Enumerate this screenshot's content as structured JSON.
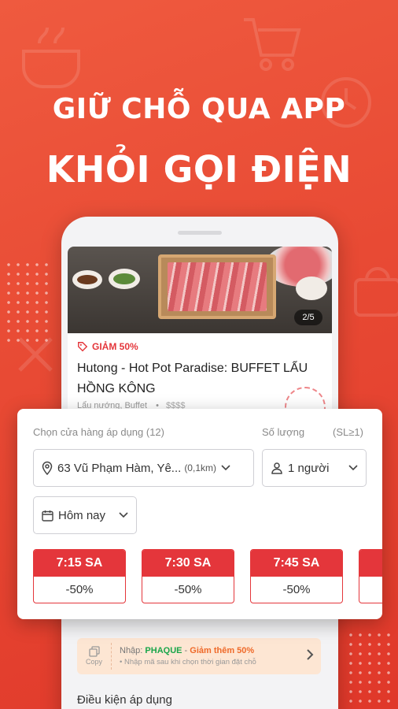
{
  "headline": {
    "line1": "GIỮ CHỖ QUA APP",
    "line2": "KHỎI GỌI ĐIỆN"
  },
  "colors": {
    "brand_red": "#e4363b",
    "background_gradient_start": "#ef5a3f",
    "background_gradient_end": "#e0382a",
    "promo_code_green": "#1aa64a",
    "promo_extra_orange": "#ef6a2a"
  },
  "restaurant_card": {
    "image_counter": "2/5",
    "discount_tag": "GIẢM 50%",
    "title": "Hutong - Hot Pot Paradise: BUFFET LẨU HỒNG KÔNG",
    "category": "Lẩu nướng, Buffet",
    "separator": "•",
    "price_level": "$$$$"
  },
  "booking": {
    "store_label": "Chọn cửa hàng áp dụng (12)",
    "quantity_label": "Số lượng",
    "quantity_hint": "(SL≥1)",
    "store_value": "63 Vũ Phạm Hàm, Yê...",
    "store_distance": "(0,1km)",
    "quantity_value": "1 người",
    "date_value": "Hôm nay",
    "time_slots": [
      {
        "time": "7:15 SA",
        "discount": "-50%"
      },
      {
        "time": "7:30 SA",
        "discount": "-50%"
      },
      {
        "time": "7:45 SA",
        "discount": "-50%"
      }
    ]
  },
  "promo": {
    "copy_label": "Copy",
    "prefix": "Nhập:",
    "code": "PHAQUE",
    "dash": " - ",
    "extra": "Giảm thêm 50%",
    "sub": "• Nhập mã sau khi chọn thời gian đặt chỗ"
  },
  "bottom_section_title": "Điều kiện áp dụng",
  "icons": {
    "tag": "tag-icon",
    "location": "location-pin-icon",
    "person": "person-icon",
    "calendar": "calendar-icon",
    "chevron": "chevron-down-icon",
    "copy": "copy-icon",
    "arrow": "chevron-right-icon"
  }
}
